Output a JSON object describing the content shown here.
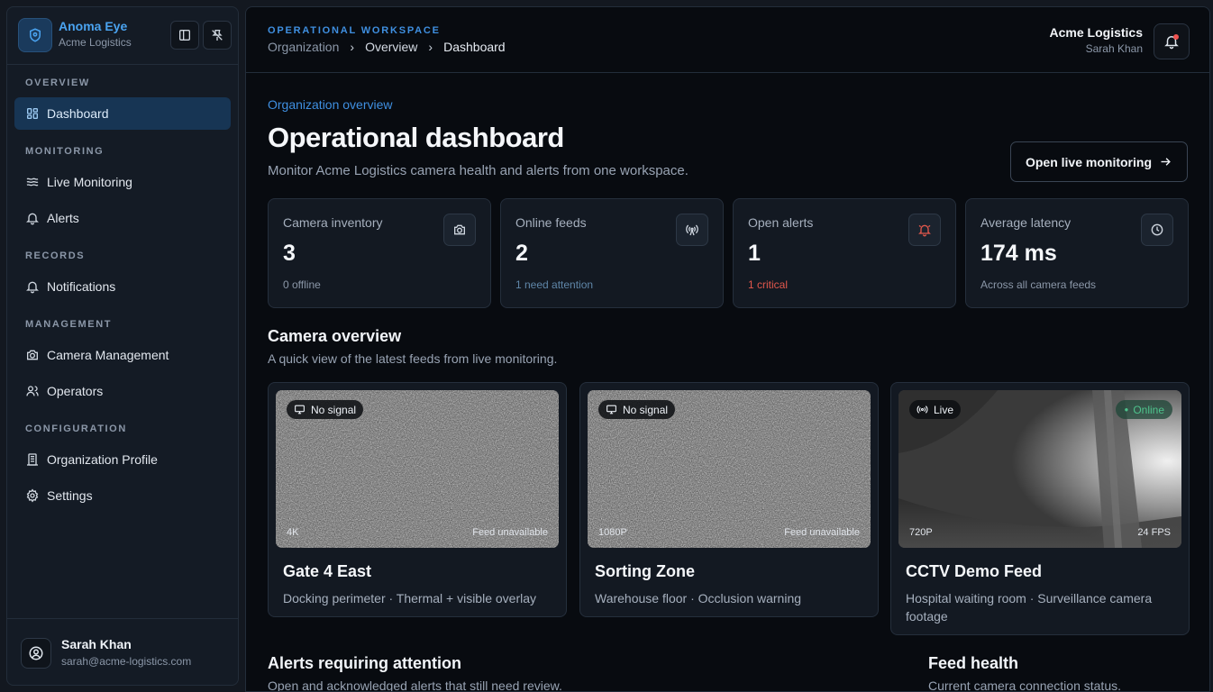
{
  "brand": {
    "name": "Anoma Eye",
    "org": "Acme Logistics"
  },
  "sidebar": {
    "sections": [
      {
        "title": "OVERVIEW",
        "items": [
          {
            "label": "Dashboard",
            "icon": "dashboard-icon",
            "active": true
          }
        ]
      },
      {
        "title": "MONITORING",
        "items": [
          {
            "label": "Live Monitoring",
            "icon": "waves-icon"
          },
          {
            "label": "Alerts",
            "icon": "bell-icon"
          }
        ]
      },
      {
        "title": "RECORDS",
        "items": [
          {
            "label": "Notifications",
            "icon": "bell-icon"
          }
        ]
      },
      {
        "title": "MANAGEMENT",
        "items": [
          {
            "label": "Camera Management",
            "icon": "camera-icon"
          },
          {
            "label": "Operators",
            "icon": "users-icon"
          }
        ]
      },
      {
        "title": "CONFIGURATION",
        "items": [
          {
            "label": "Organization Profile",
            "icon": "building-icon"
          },
          {
            "label": "Settings",
            "icon": "gear-icon"
          }
        ]
      }
    ],
    "user": {
      "name": "Sarah Khan",
      "email": "sarah@acme-logistics.com"
    }
  },
  "topbar": {
    "eyebrow": "OPERATIONAL WORKSPACE",
    "breadcrumb": [
      "Organization",
      "Overview",
      "Dashboard"
    ],
    "org": "Acme Logistics",
    "user": "Sarah Khan"
  },
  "header": {
    "overline": "Organization overview",
    "title": "Operational dashboard",
    "subtitle": "Monitor Acme Logistics camera health and alerts from one workspace.",
    "cta": "Open live monitoring"
  },
  "stats": [
    {
      "label": "Camera inventory",
      "value": "3",
      "foot": "0 offline",
      "icon": "camera-icon"
    },
    {
      "label": "Online feeds",
      "value": "2",
      "foot": "1 need attention",
      "icon": "broadcast-icon"
    },
    {
      "label": "Open alerts",
      "value": "1",
      "foot": "1 critical",
      "icon": "alarm-icon"
    },
    {
      "label": "Average latency",
      "value": "174 ms",
      "foot": "Across all camera feeds",
      "icon": "clock-icon"
    }
  ],
  "camera_overview": {
    "title": "Camera overview",
    "subtitle": "A quick view of the latest feeds from live monitoring.",
    "cameras": [
      {
        "name": "Gate 4 East",
        "desc": "Docking perimeter · Thermal + visible overlay",
        "badge": "No signal",
        "resolution": "4K",
        "right_status": "Feed unavailable"
      },
      {
        "name": "Sorting Zone",
        "desc": "Warehouse floor · Occlusion warning",
        "badge": "No signal",
        "resolution": "1080P",
        "right_status": "Feed unavailable"
      },
      {
        "name": "CCTV Demo Feed",
        "desc": "Hospital waiting room · Surveillance camera footage",
        "badge": "Live",
        "status": "Online",
        "resolution": "720P",
        "right_status": "24 FPS"
      }
    ]
  },
  "alerts_section": {
    "title": "Alerts requiring attention",
    "subtitle": "Open and acknowledged alerts that still need review."
  },
  "feed_health": {
    "title": "Feed health",
    "subtitle": "Current camera connection status."
  },
  "colors": {
    "accent": "#3f8fe0",
    "critical": "#e2574c",
    "online": "#4ec28c",
    "active_nav": "#173554"
  }
}
